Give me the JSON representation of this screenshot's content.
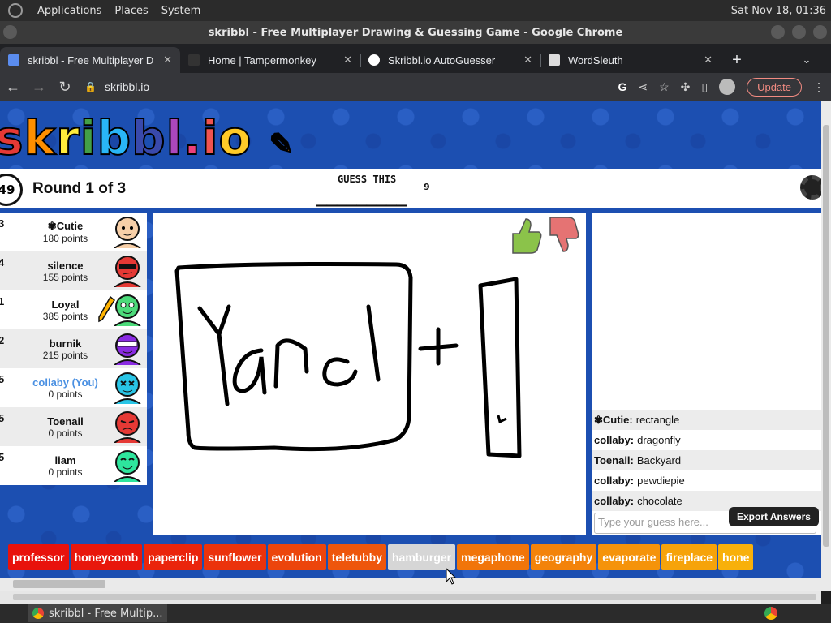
{
  "topbar": {
    "menus": [
      "Applications",
      "Places",
      "System"
    ],
    "clock": "Sat Nov 18, 01:36"
  },
  "window": {
    "title": "skribbl - Free Multiplayer Drawing & Guessing Game - Google Chrome"
  },
  "tabs": [
    {
      "label": "skribbl - Free Multiplayer D",
      "icon": "pencil-icon"
    },
    {
      "label": "Home | Tampermonkey",
      "icon": "tampermonkey-icon"
    },
    {
      "label": "Skribbl.io AutoGuesser",
      "icon": "greasyfork-icon"
    },
    {
      "label": "WordSleuth",
      "icon": "github-icon"
    }
  ],
  "address": {
    "url": "skribbl.io",
    "update_label": "Update"
  },
  "game": {
    "logo": "skribbl.io",
    "timer": "49",
    "round": "Round 1 of 3",
    "guess_label": "GUESS THIS",
    "blanks": "_________",
    "word_length": "9"
  },
  "players": [
    {
      "rank": "3",
      "name": "✾Cutie",
      "points": "180 points",
      "avatar_color": "#f7cfa8"
    },
    {
      "rank": "4",
      "name": "silence",
      "points": "155 points",
      "avatar_color": "#e53935"
    },
    {
      "rank": "1",
      "name": "Loyal",
      "points": "385 points",
      "avatar_color": "#4cdb7a"
    },
    {
      "rank": "2",
      "name": "burnik",
      "points": "215 points",
      "avatar_color": "#8a2be2"
    },
    {
      "rank": "5",
      "name": "collaby (You)",
      "points": "0 points",
      "avatar_color": "#29c5e6"
    },
    {
      "rank": "5",
      "name": "Toenail",
      "points": "0 points",
      "avatar_color": "#e53935"
    },
    {
      "rank": "5",
      "name": "liam",
      "points": "0 points",
      "avatar_color": "#2ee59d"
    }
  ],
  "bubble": "chocolate",
  "chat": [
    {
      "user": "✾Cutie:",
      "text": "rectangle"
    },
    {
      "user": "collaby:",
      "text": "dragonfly"
    },
    {
      "user": "Toenail:",
      "text": "Backyard"
    },
    {
      "user": "collaby:",
      "text": "pewdiepie"
    },
    {
      "user": "collaby:",
      "text": "chocolate"
    }
  ],
  "guess_placeholder": "Type your guess here...",
  "export_label": "Export Answers",
  "words": [
    {
      "text": "professor",
      "color": "#e8120c"
    },
    {
      "text": "honeycomb",
      "color": "#e8170c"
    },
    {
      "text": "paperclip",
      "color": "#ea250c"
    },
    {
      "text": "sunflower",
      "color": "#eb330c"
    },
    {
      "text": "evolution",
      "color": "#ec450c"
    },
    {
      "text": "teletubby",
      "color": "#ee560c"
    },
    {
      "text": "hamburger",
      "color": "#d6d6d6"
    },
    {
      "text": "megaphone",
      "color": "#f1750a"
    },
    {
      "text": "geography",
      "color": "#f3830a"
    },
    {
      "text": "evaporate",
      "color": "#f5930a"
    },
    {
      "text": "fireplace",
      "color": "#f6a30a"
    },
    {
      "text": "hone",
      "color": "#f8b00a"
    }
  ],
  "taskbar": {
    "item": "skribbl - Free Multip..."
  }
}
